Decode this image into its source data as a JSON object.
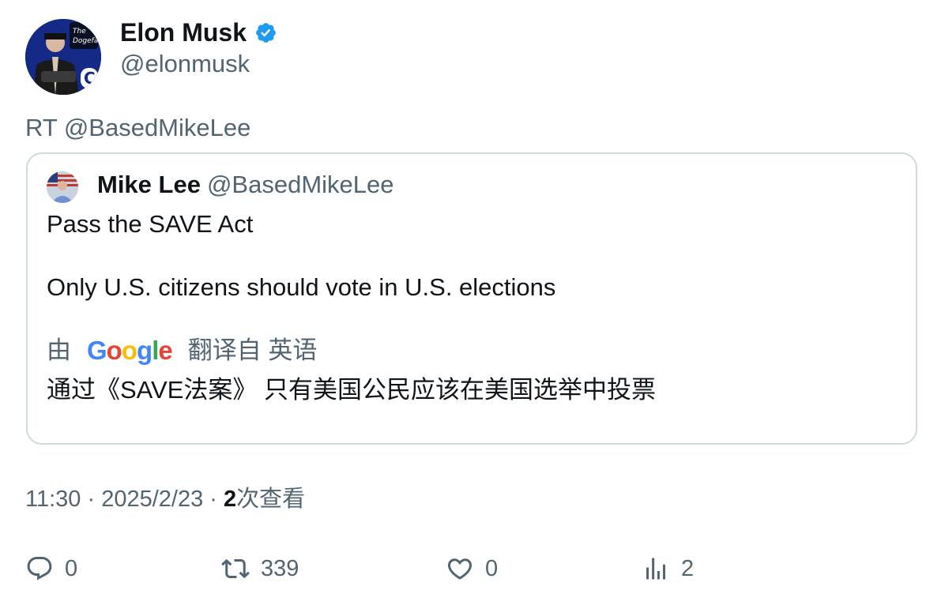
{
  "author": {
    "name": "Elon Musk",
    "handle": "@elonmusk",
    "avatar_icon": "profile-photo"
  },
  "retweet_text": "RT @BasedMikeLee",
  "quote": {
    "name": "Mike Lee",
    "handle": "@BasedMikeLee",
    "line1": "Pass the SAVE Act",
    "line2": "Only U.S. citizens should vote in U.S. elections",
    "translate_prefix": "由",
    "translate_brand": "Google",
    "translate_suffix": "翻译自 英语",
    "translated": "通过《SAVE法案》 只有美国公民应该在美国选举中投票"
  },
  "meta": {
    "time": "11:30",
    "date": "2025/2/23",
    "views_count": "2",
    "views_label": "次查看",
    "separator": "·"
  },
  "actions": {
    "reply_count": "0",
    "retweet_count": "339",
    "like_count": "0",
    "views_count": "2"
  },
  "colors": {
    "verified": "#1d9bf0",
    "secondary_text": "#536471",
    "border": "#cfd9de",
    "google_blue": "#4285F4",
    "google_red": "#EA4335",
    "google_yellow": "#FBBC05",
    "google_green": "#34A853"
  }
}
